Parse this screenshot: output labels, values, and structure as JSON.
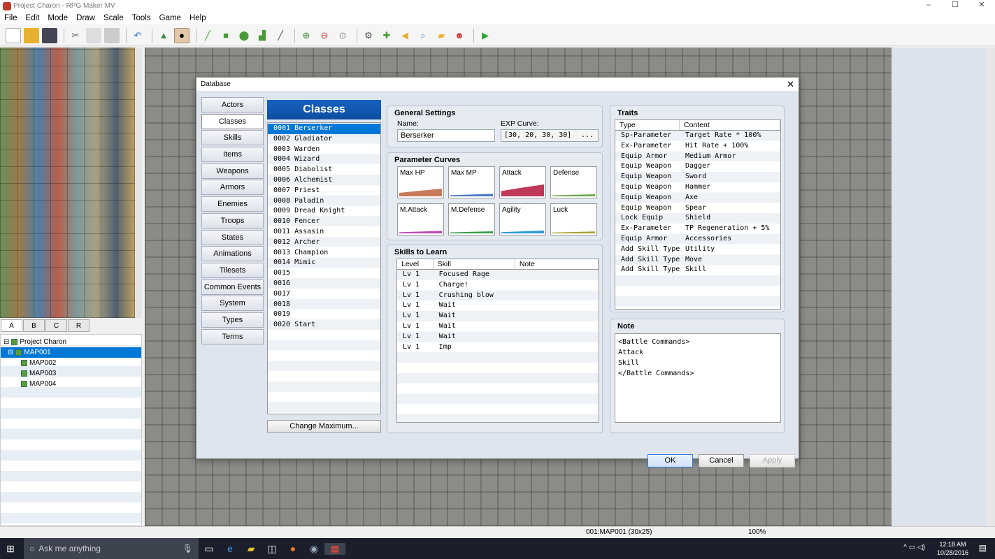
{
  "window": {
    "title": "Project Charon - RPG Maker MV",
    "minimize": "–",
    "maximize": "☐",
    "close": "✕"
  },
  "menu": [
    "File",
    "Edit",
    "Mode",
    "Draw",
    "Scale",
    "Tools",
    "Game",
    "Help"
  ],
  "layer_tabs": [
    "A",
    "B",
    "C",
    "R"
  ],
  "map_tree": {
    "project": "Project Charon",
    "maps": [
      "MAP001",
      "MAP002",
      "MAP003",
      "MAP004"
    ],
    "selected": "MAP001"
  },
  "status": {
    "map": "001:MAP001 (30x25)",
    "zoom": "100%"
  },
  "taskbar": {
    "search": "Ask me anything",
    "time": "12:18 AM",
    "date": "10/28/2016"
  },
  "dialog": {
    "title": "Database",
    "close": "✕",
    "tabs": [
      "Actors",
      "Classes",
      "Skills",
      "Items",
      "Weapons",
      "Armors",
      "Enemies",
      "Troops",
      "States",
      "Animations",
      "Tilesets",
      "Common Events",
      "System",
      "Types",
      "Terms"
    ],
    "selected_tab": "Classes",
    "list_header": "Classes",
    "classes": [
      "0001 Berserker",
      "0002 Gladiator",
      "0003 Warden",
      "0004 Wizard",
      "0005 Diabolist",
      "0006 Alchemist",
      "0007 Priest",
      "0008 Paladin",
      "0009 Dread Knight",
      "0010 Fencer",
      "0011 Assasin",
      "0012 Archer",
      "0013 Champion",
      "0014 Mimic",
      "0015",
      "0016",
      "0017",
      "0018",
      "0019",
      "0020 Start"
    ],
    "selected_class_index": 0,
    "change_max": "Change Maximum...",
    "general": {
      "title": "General Settings",
      "name_label": "Name:",
      "name_value": "Berserker",
      "exp_label": "EXP Curve:",
      "exp_value": "[30, 20, 30, 30]",
      "exp_btn": "..."
    },
    "params": {
      "title": "Parameter Curves",
      "curves": [
        {
          "label": "Max HP",
          "color": "#c87a5a",
          "level": 0.45
        },
        {
          "label": "Max MP",
          "color": "#4a7ac8",
          "level": 0.08
        },
        {
          "label": "Attack",
          "color": "#c03858",
          "level": 0.75
        },
        {
          "label": "Defense",
          "color": "#6aa84a",
          "level": 0.05
        },
        {
          "label": "M.Attack",
          "color": "#b84ab0",
          "level": 0.08
        },
        {
          "label": "M.Defense",
          "color": "#3a9a4a",
          "level": 0.05
        },
        {
          "label": "Agility",
          "color": "#2a9ad0",
          "level": 0.1
        },
        {
          "label": "Luck",
          "color": "#a8a030",
          "level": 0.04
        }
      ]
    },
    "skills": {
      "title": "Skills to Learn",
      "headers": [
        "Level",
        "Skill",
        "Note"
      ],
      "rows": [
        [
          "Lv  1",
          "Focused Rage",
          ""
        ],
        [
          "Lv  1",
          "Charge!",
          ""
        ],
        [
          "Lv  1",
          "Crushing blow",
          ""
        ],
        [
          "Lv  1",
          "Wait",
          ""
        ],
        [
          "Lv  1",
          "Wait",
          ""
        ],
        [
          "Lv  1",
          "Wait",
          ""
        ],
        [
          "Lv  1",
          "Wait",
          ""
        ],
        [
          "Lv  1",
          "Imp",
          ""
        ]
      ]
    },
    "traits": {
      "title": "Traits",
      "headers": [
        "Type",
        "Content"
      ],
      "rows": [
        [
          "Sp-Parameter",
          "Target Rate * 100%"
        ],
        [
          "Ex-Parameter",
          "Hit Rate + 100%"
        ],
        [
          "Equip Armor",
          "Medium Armor"
        ],
        [
          "Equip Weapon",
          "Dagger"
        ],
        [
          "Equip Weapon",
          "Sword"
        ],
        [
          "Equip Weapon",
          "Hammer"
        ],
        [
          "Equip Weapon",
          "Axe"
        ],
        [
          "Equip Weapon",
          "Spear"
        ],
        [
          "Lock Equip",
          "Shield"
        ],
        [
          "Ex-Parameter",
          "TP Regeneration + 5%"
        ],
        [
          "Equip Armor",
          "Accessories"
        ],
        [
          "Add Skill Type",
          "Utility"
        ],
        [
          "Add Skill Type",
          "Move"
        ],
        [
          "Add Skill Type",
          "Skill"
        ]
      ]
    },
    "note": {
      "title": "Note",
      "lines": [
        "<Battle Commands>",
        "Attack",
        "Skill",
        "</Battle Commands>"
      ]
    },
    "buttons": {
      "ok": "OK",
      "cancel": "Cancel",
      "apply": "Apply"
    }
  }
}
